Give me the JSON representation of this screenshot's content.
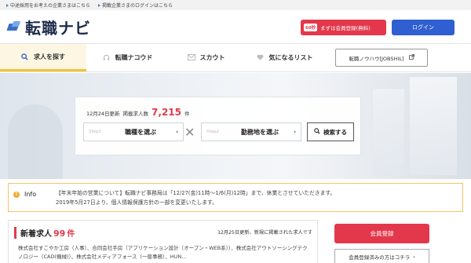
{
  "topbar": {
    "links": [
      "中途採用をお考えの企業さまはこちら",
      "掲載企業さまのログインはこちら"
    ]
  },
  "header": {
    "logo": "転職ナビ",
    "register_badge": "60秒",
    "register_label": "まずは会員登録(無料)",
    "login_label": "ログイン"
  },
  "nav": {
    "items": [
      {
        "label": "求人を探す",
        "icon": "search-icon"
      },
      {
        "label": "転職ナコウド",
        "icon": "headset-icon"
      },
      {
        "label": "スカウト",
        "icon": "mail-icon"
      },
      {
        "label": "気になるリスト",
        "icon": "heart-icon"
      }
    ],
    "knowhow_label": "転職ノウハウ[JOBSHIL]"
  },
  "search": {
    "updated": "12月24日更新",
    "count_label": "掲載求人数",
    "count": "7,215",
    "count_unit": "件",
    "step1": "Step1",
    "step1_label": "職種を選ぶ",
    "step2": "Step2",
    "step2_label": "勤務地を選ぶ",
    "search_button": "検索する"
  },
  "info": {
    "label": "Info",
    "line1": "【年末年始の営業について】転職ナビ事務局は「12/27(金)11時〜1/6(月)12時」まで、休業とさせていただきます。",
    "line2": "2019年5月27日より、個人情報保護方針の一部を変更いたします。"
  },
  "new_jobs": {
    "title": "新着求人",
    "count": "99",
    "unit": "件",
    "date_text": "12月25日更新、新規に掲載された求人です",
    "body": "株式会社すこやか工房（人事）、合同会社手房（アプリケーション設計（オープン・WEB系））、株式会社アウトソーシングテクノロジー（CAD(機械)）、株式会社メディアフォース（一般事務）、HUN…"
  },
  "side": {
    "register_label": "会員登録",
    "already_label": "会員登録済みの方はコチラ"
  },
  "colors": {
    "accent_red": "#e3384b",
    "accent_blue": "#2f5fd0",
    "nav_active_bg": "#fdf6e3",
    "nav_active_border": "#f1c232",
    "info_border": "#f2c46b"
  }
}
